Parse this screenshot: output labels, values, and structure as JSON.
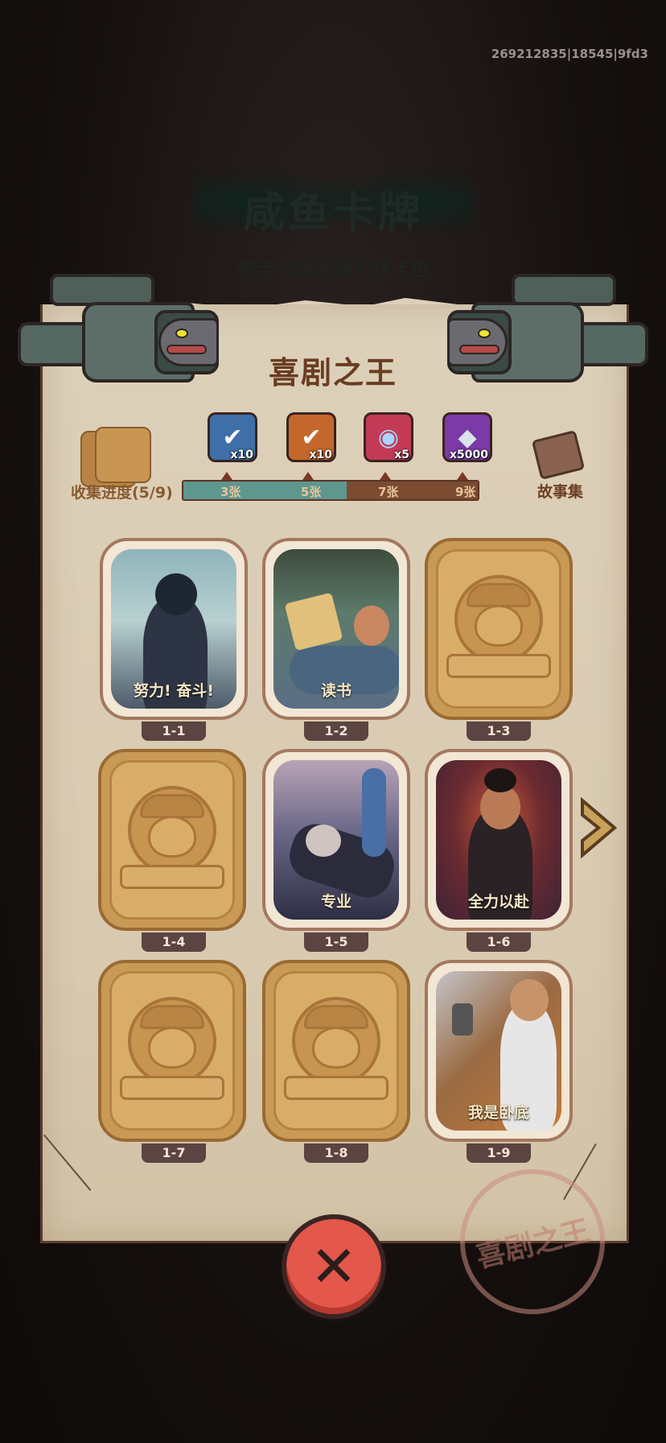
{
  "uid": "269212835|18545|9fd3",
  "background": {
    "title": "咸鱼卡牌",
    "subtitle": "参与卡牌活动可获卡包"
  },
  "panel": {
    "title": "喜剧之王",
    "progress_label": "收集进度(5/9)",
    "progress_fraction": 0.556,
    "story_label": "故事集",
    "milestones": [
      "3张",
      "5张",
      "7张",
      "9张"
    ],
    "rewards": [
      {
        "icon": "chest-check-icon",
        "qty": "x10",
        "color": "#3f6fa8"
      },
      {
        "icon": "key-check-icon",
        "qty": "x10",
        "color": "#c4672c"
      },
      {
        "icon": "swirl-orb-icon",
        "qty": "x5",
        "color": "#c23a56"
      },
      {
        "icon": "crystal-icon",
        "qty": "x5000",
        "color": "#7b3aa8"
      }
    ]
  },
  "cards": [
    {
      "id": "1-1",
      "caption": "努力! 奋斗!",
      "unlocked": true
    },
    {
      "id": "1-2",
      "caption": "读书",
      "unlocked": true
    },
    {
      "id": "1-3",
      "caption": "",
      "unlocked": false
    },
    {
      "id": "1-4",
      "caption": "",
      "unlocked": false
    },
    {
      "id": "1-5",
      "caption": "专业",
      "unlocked": true
    },
    {
      "id": "1-6",
      "caption": "全力以赴",
      "unlocked": true
    },
    {
      "id": "1-7",
      "caption": "",
      "unlocked": false
    },
    {
      "id": "1-8",
      "caption": "",
      "unlocked": false
    },
    {
      "id": "1-9",
      "caption": "我是卧底",
      "unlocked": true
    }
  ],
  "stamp_text": "喜剧之王",
  "colors": {
    "accent_red": "#e4574b",
    "progress_fill": "#5e978e",
    "title_brown": "#6a3d22"
  }
}
